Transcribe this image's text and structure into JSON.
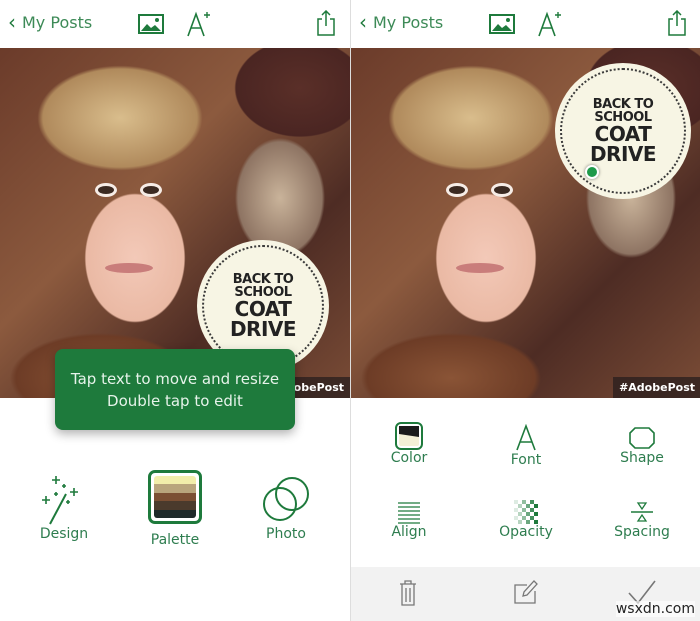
{
  "colors": {
    "accent": "#1e7a3c",
    "badge_bg": "#f7f5e4",
    "toast_bg": "#1e7a3c"
  },
  "nav": {
    "back_label": "My Posts",
    "icons": [
      "chevron-left-icon",
      "image-icon",
      "add-text-icon",
      "share-icon"
    ]
  },
  "badge": {
    "line1": "BACK TO",
    "line2": "SCHOOL",
    "line3": "COAT",
    "line4": "DRIVE"
  },
  "hashtag": "#AdobePost",
  "left": {
    "toast": {
      "line1": "Tap text to move and resize",
      "line2": "Double tap to edit"
    },
    "tools": [
      {
        "label": "Design",
        "icon": "magic-wand-icon"
      },
      {
        "label": "Palette",
        "icon": "palette-icon"
      },
      {
        "label": "Photo",
        "icon": "photo-filter-icon"
      }
    ],
    "palette_colors": [
      "#f2eeaa",
      "#b9a57c",
      "#7b4f33",
      "#4a3a2c",
      "#1f2a2a"
    ]
  },
  "right": {
    "tools": [
      {
        "label": "Color",
        "icon": "color-swatch-icon"
      },
      {
        "label": "Font",
        "icon": "font-icon"
      },
      {
        "label": "Shape",
        "icon": "shape-icon"
      },
      {
        "label": "Align",
        "icon": "align-icon"
      },
      {
        "label": "Opacity",
        "icon": "opacity-icon"
      },
      {
        "label": "Spacing",
        "icon": "spacing-icon"
      }
    ],
    "bottom_icons": [
      "trash-icon",
      "edit-icon",
      "checkmark-icon"
    ]
  },
  "watermark": "wsxdn.com"
}
